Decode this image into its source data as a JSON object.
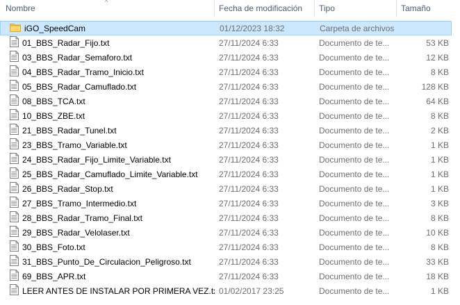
{
  "columns": {
    "name": "Nombre",
    "date": "Fecha de modificación",
    "type": "Tipo",
    "size": "Tamaño"
  },
  "sort_arrow": "^",
  "rows": [
    {
      "icon": "folder-icon",
      "name": "iGO_SpeedCam",
      "date": "01/12/2023 18:32",
      "type": "Carpeta de archivos",
      "size": "",
      "selected": true
    },
    {
      "icon": "text-file-icon",
      "name": "01_BBS_Radar_Fijo.txt",
      "date": "27/11/2024 6:33",
      "type": "Documento de te...",
      "size": "53 KB"
    },
    {
      "icon": "text-file-icon",
      "name": "03_BBS_Radar_Semaforo.txt",
      "date": "27/11/2024 6:33",
      "type": "Documento de te...",
      "size": "12 KB"
    },
    {
      "icon": "text-file-icon",
      "name": "04_BBS_Radar_Tramo_Inicio.txt",
      "date": "27/11/2024 6:33",
      "type": "Documento de te...",
      "size": "8 KB"
    },
    {
      "icon": "text-file-icon",
      "name": "05_BBS_Radar_Camuflado.txt",
      "date": "27/11/2024 6:33",
      "type": "Documento de te...",
      "size": "128 KB"
    },
    {
      "icon": "text-file-icon",
      "name": "08_BBS_TCA.txt",
      "date": "27/11/2024 6:33",
      "type": "Documento de te...",
      "size": "64 KB"
    },
    {
      "icon": "text-file-icon",
      "name": "10_BBS_ZBE.txt",
      "date": "27/11/2024 6:33",
      "type": "Documento de te...",
      "size": "8 KB"
    },
    {
      "icon": "text-file-icon",
      "name": "21_BBS_Radar_Tunel.txt",
      "date": "27/11/2024 6:33",
      "type": "Documento de te...",
      "size": "2 KB"
    },
    {
      "icon": "text-file-icon",
      "name": "23_BBS_Tramo_Variable.txt",
      "date": "27/11/2024 6:33",
      "type": "Documento de te...",
      "size": "1 KB"
    },
    {
      "icon": "text-file-icon",
      "name": "24_BBS_Radar_Fijo_Limite_Variable.txt",
      "date": "27/11/2024 6:33",
      "type": "Documento de te...",
      "size": "1 KB"
    },
    {
      "icon": "text-file-icon",
      "name": "25_BBS_Radar_Camuflado_Limite_Variable.txt",
      "date": "27/11/2024 6:33",
      "type": "Documento de te...",
      "size": "1 KB"
    },
    {
      "icon": "text-file-icon",
      "name": "26_BBS_Radar_Stop.txt",
      "date": "27/11/2024 6:33",
      "type": "Documento de te...",
      "size": "1 KB"
    },
    {
      "icon": "text-file-icon",
      "name": "27_BBS_Tramo_Intermedio.txt",
      "date": "27/11/2024 6:33",
      "type": "Documento de te...",
      "size": "3 KB"
    },
    {
      "icon": "text-file-icon",
      "name": "28_BBS_Radar_Tramo_Final.txt",
      "date": "27/11/2024 6:33",
      "type": "Documento de te...",
      "size": "8 KB"
    },
    {
      "icon": "text-file-icon",
      "name": "29_BBS_Radar_Velolaser.txt",
      "date": "27/11/2024 6:33",
      "type": "Documento de te...",
      "size": "10 KB"
    },
    {
      "icon": "text-file-icon",
      "name": "30_BBS_Foto.txt",
      "date": "27/11/2024 6:33",
      "type": "Documento de te...",
      "size": "8 KB"
    },
    {
      "icon": "text-file-icon",
      "name": "31_BBS_Punto_De_Circulacion_Peligroso.txt",
      "date": "27/11/2024 6:33",
      "type": "Documento de te...",
      "size": "33 KB"
    },
    {
      "icon": "text-file-icon",
      "name": "69_BBS_APR.txt",
      "date": "27/11/2024 6:33",
      "type": "Documento de te...",
      "size": "18 KB"
    },
    {
      "icon": "text-file-icon",
      "name": "LEER ANTES DE INSTALAR POR PRIMERA VEZ.txt",
      "date": "01/02/2017 23:25",
      "type": "Documento de te...",
      "size": "1 KB"
    }
  ],
  "colors": {
    "header_text": "#4d5b73",
    "meta_text": "#6d6d6d",
    "selection_bg": "#cce8ff",
    "selection_border": "#99d1ff",
    "folder": "#f3c94f"
  }
}
